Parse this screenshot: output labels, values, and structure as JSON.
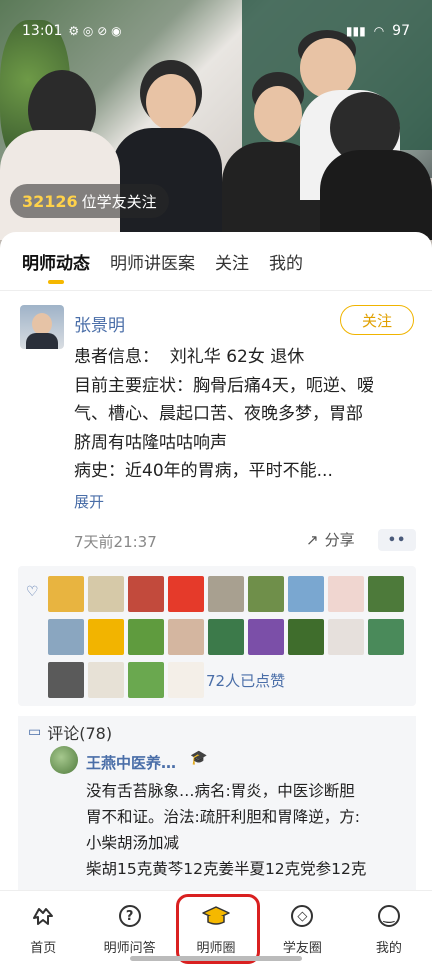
{
  "status_bar": {
    "time": "13:01",
    "battery": "97"
  },
  "hero": {
    "follower_count": "32126",
    "follower_suffix": "位学友关注"
  },
  "tabs": [
    {
      "label": "明师动态",
      "active": true
    },
    {
      "label": "明师讲医案",
      "active": false
    },
    {
      "label": "关注",
      "active": false
    },
    {
      "label": "我的",
      "active": false
    }
  ],
  "post": {
    "author": "张景明",
    "follow_label": "关注",
    "lines": [
      "患者信息：  刘礼华 62女 退休",
      "目前主要症状：胸骨后痛4天，呃逆、嗳",
      "气、槽心、晨起口苦、夜晚多梦，胃部",
      "脐周有咕隆咕咕响声",
      "病史：近40年的胃病，平时不能..."
    ],
    "expand_label": "展开",
    "time": "7天前21:37",
    "share_label": "分享",
    "more_label": "••"
  },
  "likes": {
    "count_text": "72人已点赞"
  },
  "comments": {
    "title": "评论(78)",
    "first": {
      "name": "王燕中医养…",
      "lines": [
        "没有舌苔脉象…病名:胃炎，中医诊断胆",
        "胃不和证。治法:疏肝利胆和胃降逆，方:",
        "小柴胡汤加减",
        "柴胡15克黄芩12克姜半夏12克党参12克"
      ]
    }
  },
  "nav": [
    {
      "label": "首页",
      "icon": "home-icon"
    },
    {
      "label": "明师问答",
      "icon": "question-icon"
    },
    {
      "label": "明师圈",
      "icon": "graduation-cap-icon",
      "active": true
    },
    {
      "label": "学友圈",
      "icon": "compass-icon"
    },
    {
      "label": "我的",
      "icon": "smile-icon"
    }
  ],
  "colors": {
    "accent": "#f5b800",
    "link": "#4a6ea8",
    "highlight_box": "#d92020"
  }
}
